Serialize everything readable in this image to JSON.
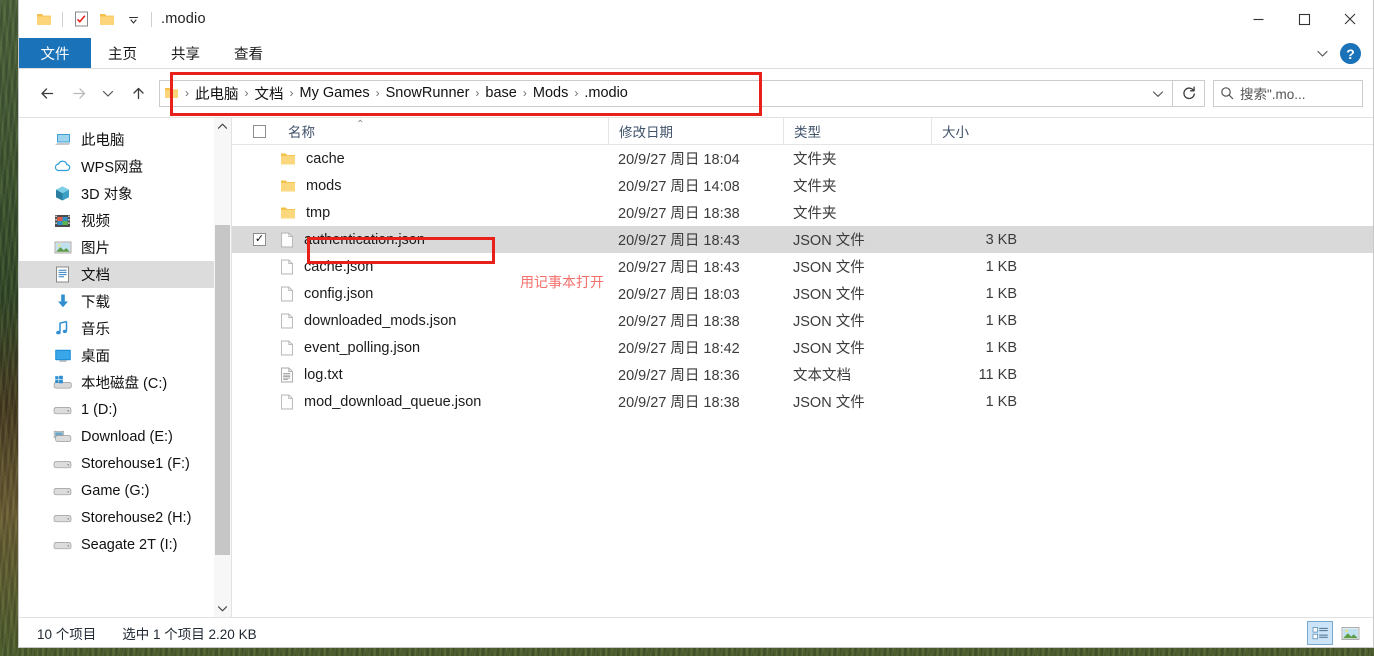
{
  "window": {
    "title": ".modio",
    "quick_access": [
      {
        "name": "folder-icon",
        "label": "文件夹"
      },
      {
        "name": "properties-icon",
        "label": "属性"
      },
      {
        "name": "new-folder-icon",
        "label": "新建文件夹"
      },
      {
        "name": "customize-qat-dropdown",
        "label": "自定义快速访问工具栏"
      }
    ],
    "caption": {
      "minimize": "最小化",
      "maximize": "最大化",
      "close": "关闭"
    }
  },
  "ribbon": {
    "tabs": [
      {
        "label": "文件",
        "selected": true
      },
      {
        "label": "主页",
        "selected": false
      },
      {
        "label": "共享",
        "selected": false
      },
      {
        "label": "查看",
        "selected": false
      }
    ],
    "collapse_label": "展开功能区",
    "help_label": "?"
  },
  "address": {
    "back": "后退",
    "forward": "前进",
    "recent": "最近浏览的位置",
    "up": "上移到",
    "breadcrumbs": [
      "此电脑",
      "文档",
      "My Games",
      "SnowRunner",
      "base",
      "Mods",
      ".modio"
    ],
    "separator": "›",
    "dropdown": "⌄",
    "refresh": "刷新",
    "search_placeholder": "搜索\".mo..."
  },
  "sidebar": {
    "items": [
      {
        "label": "此电脑",
        "icon": "computer-icon",
        "selected": false
      },
      {
        "label": "WPS网盘",
        "icon": "cloud-icon",
        "selected": false
      },
      {
        "label": "3D 对象",
        "icon": "cube-icon",
        "selected": false
      },
      {
        "label": "视频",
        "icon": "video-icon",
        "selected": false
      },
      {
        "label": "图片",
        "icon": "picture-icon",
        "selected": false
      },
      {
        "label": "文档",
        "icon": "document-icon",
        "selected": true
      },
      {
        "label": "下载",
        "icon": "download-icon",
        "selected": false
      },
      {
        "label": "音乐",
        "icon": "music-icon",
        "selected": false
      },
      {
        "label": "桌面",
        "icon": "desktop-icon",
        "selected": false
      },
      {
        "label": "本地磁盘 (C:)",
        "icon": "windows-drive-icon",
        "selected": false
      },
      {
        "label": "1 (D:)",
        "icon": "drive-icon",
        "selected": false
      },
      {
        "label": "Download (E:)",
        "icon": "drive-icon",
        "selected": false
      },
      {
        "label": "Storehouse1 (F:)",
        "icon": "drive-icon",
        "selected": false
      },
      {
        "label": "Game (G:)",
        "icon": "drive-icon",
        "selected": false
      },
      {
        "label": "Storehouse2 (H:)",
        "icon": "drive-icon",
        "selected": false
      },
      {
        "label": "Seagate 2T (I:)",
        "icon": "drive-icon",
        "selected": false
      }
    ],
    "scroll_up": "向上滚动",
    "scroll_down": "向下滚动"
  },
  "filelist": {
    "columns": {
      "name": "名称",
      "date": "修改日期",
      "type": "类型",
      "size": "大小"
    },
    "sort_indicator": "⌃",
    "rows": [
      {
        "name": "cache",
        "date": "20/9/27 周日 18:04",
        "type": "文件夹",
        "size": "",
        "icon": "folder-icon",
        "selected": false
      },
      {
        "name": "mods",
        "date": "20/9/27 周日 14:08",
        "type": "文件夹",
        "size": "",
        "icon": "folder-icon",
        "selected": false
      },
      {
        "name": "tmp",
        "date": "20/9/27 周日 18:38",
        "type": "文件夹",
        "size": "",
        "icon": "folder-icon",
        "selected": false
      },
      {
        "name": "authentication.json",
        "date": "20/9/27 周日 18:43",
        "type": "JSON 文件",
        "size": "3 KB",
        "icon": "file-icon",
        "selected": true
      },
      {
        "name": "cache.json",
        "date": "20/9/27 周日 18:43",
        "type": "JSON 文件",
        "size": "1 KB",
        "icon": "file-icon",
        "selected": false
      },
      {
        "name": "config.json",
        "date": "20/9/27 周日 18:03",
        "type": "JSON 文件",
        "size": "1 KB",
        "icon": "file-icon",
        "selected": false
      },
      {
        "name": "downloaded_mods.json",
        "date": "20/9/27 周日 18:38",
        "type": "JSON 文件",
        "size": "1 KB",
        "icon": "file-icon",
        "selected": false
      },
      {
        "name": "event_polling.json",
        "date": "20/9/27 周日 18:42",
        "type": "JSON 文件",
        "size": "1 KB",
        "icon": "file-icon",
        "selected": false
      },
      {
        "name": "log.txt",
        "date": "20/9/27 周日 18:36",
        "type": "文本文档",
        "size": "11 KB",
        "icon": "text-file-icon",
        "selected": false
      },
      {
        "name": "mod_download_queue.json",
        "date": "20/9/27 周日 18:38",
        "type": "JSON 文件",
        "size": "1 KB",
        "icon": "file-icon",
        "selected": false
      }
    ]
  },
  "statusbar": {
    "item_count": "10 个项目",
    "selection": "选中 1 个项目  2.20 KB",
    "details_view": "详细信息",
    "large_icons_view": "大图标"
  },
  "annotations": {
    "breadcrumb_box": "",
    "file_box": "",
    "note": "用记事本打开",
    "color": "#e8201a",
    "note_color": "#f4706c"
  }
}
